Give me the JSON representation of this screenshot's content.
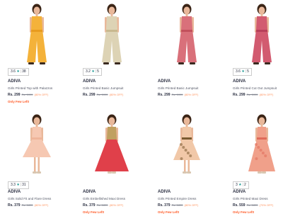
{
  "products": [
    {
      "brand": "ADIVA",
      "name": "Girls Printed Top with Palazzos",
      "price": "Rs. 299",
      "mrp": "Rs. 1099",
      "off": "(80% OFF)",
      "rating": "3.6",
      "count": "38",
      "few": "Only Few Left!",
      "colors": {
        "main": "#f4b23a",
        "accent": "#e89b1e",
        "skin": "#e9b89a",
        "hair": "#3a2416"
      }
    },
    {
      "brand": "ADIVA",
      "name": "Girls Printed Basic Jumpsuit",
      "price": "Rs. 299",
      "mrp": "Rs. 1099",
      "off": "(80% OFF)",
      "rating": "3.2",
      "count": "5",
      "few": "",
      "colors": {
        "main": "#ddd3b5",
        "accent": "#c8b98f",
        "skin": "#e9b89a",
        "hair": "#3a2416"
      }
    },
    {
      "brand": "ADIVA",
      "name": "Girls Printed Basic Jumpsuit",
      "price": "Rs. 299",
      "mrp": "Rs. 1099",
      "off": "(80% OFF)",
      "rating": "",
      "count": "",
      "few": "",
      "colors": {
        "main": "#d9707a",
        "accent": "#c2505c",
        "skin": "#e9b89a",
        "hair": "#3a2416"
      }
    },
    {
      "brand": "ADIVA",
      "name": "Girls Printed Cut Out Jumpsuit",
      "price": "Rs. 299",
      "mrp": "Rs. 1099",
      "off": "(80% OFF)",
      "rating": "3.6",
      "count": "5",
      "few": "",
      "colors": {
        "main": "#d25b70",
        "accent": "#b8405a",
        "skin": "#e9b89a",
        "hair": "#3a2416"
      }
    },
    {
      "brand": "ADIVA",
      "name": "Girls Solid Fit and Flare Dress",
      "price": "Rs. 379",
      "mrp": "Rs. 1899",
      "off": "(80% OFF)",
      "rating": "3.3",
      "count": "31",
      "few": "",
      "colors": {
        "main": "#f6c8b2",
        "accent": "#efb59a",
        "skin": "#e9b89a",
        "hair": "#3a2416"
      }
    },
    {
      "brand": "ADIVA",
      "name": "Girls Embellished Maxi Dress",
      "price": "Rs. 379",
      "mrp": "Rs. 1899",
      "off": "(80% OFF)",
      "rating": "",
      "count": "",
      "few": "Only Few Left!",
      "colors": {
        "main": "#e0404a",
        "accent": "#c0a060",
        "skin": "#e9b89a",
        "hair": "#3a2416"
      }
    },
    {
      "brand": "ADIVA",
      "name": "Girls Printed Empire Dress",
      "price": "Rs. 379",
      "mrp": "Rs. 1899",
      "off": "(80% OFF)",
      "rating": "",
      "count": "",
      "few": "Only Few Left!",
      "colors": {
        "main": "#f1c8a8",
        "accent": "#7a5a30",
        "skin": "#e9b89a",
        "hair": "#3a2416"
      }
    },
    {
      "brand": "ADIVA",
      "name": "Girls Printed Maxi Dress",
      "price": "Rs. 559",
      "mrp": "Rs. 1899",
      "off": "(70% OFF)",
      "rating": "3",
      "count": "2",
      "few": "Only Few Left!",
      "colors": {
        "main": "#f0a08a",
        "accent": "#e06b5a",
        "skin": "#e9b89a",
        "hair": "#3a2416"
      }
    }
  ]
}
